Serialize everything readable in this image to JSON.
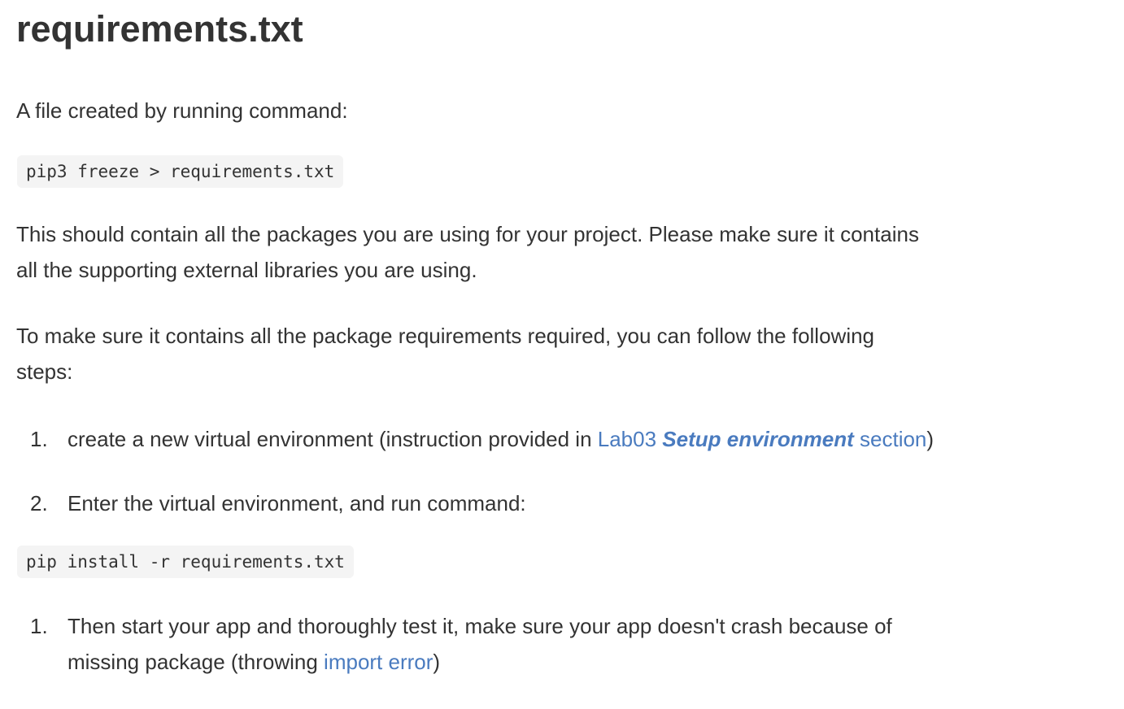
{
  "title": "requirements.txt",
  "intro": "A file created by running command:",
  "code_freeze": "pip3 freeze > requirements.txt",
  "para1_line1": "This should contain all the packages you are using for your project. Please make sure it contains",
  "para1_line2": "all the supporting external libraries you are using.",
  "para2_line1": "To make sure it contains all the package requirements required, you can follow the following",
  "para2_line2": "steps:",
  "step1": {
    "number": "1.",
    "text": "create a new virtual environment (instruction provided in ",
    "link_prefix": "Lab03 ",
    "link_bold": "Setup environment",
    "link_suffix": " section",
    "closing": ")"
  },
  "step2": {
    "number": "2.",
    "text": "Enter the virtual environment, and run command:"
  },
  "code_install": "pip install -r requirements.txt",
  "step3": {
    "number": "1.",
    "line1": "Then start your app and thoroughly test it, make sure your app doesn't crash because of",
    "line2_prefix": "missing package (throwing ",
    "link": "import error",
    "closing": ")"
  },
  "link_color": "#4a7bbf"
}
